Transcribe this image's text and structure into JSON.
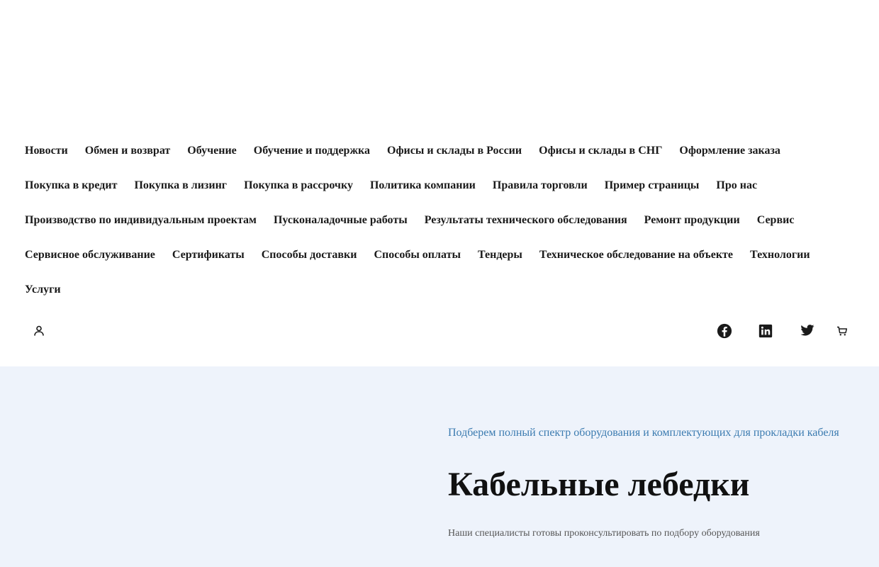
{
  "nav": {
    "items": [
      "Новости",
      "Обмен и возврат",
      "Обучение",
      "Обучение и поддержка",
      "Офисы и склады в России",
      "Офисы и склады в СНГ",
      "Оформление заказа",
      "Покупка в кредит",
      "Покупка в лизинг",
      "Покупка в рассрочку",
      "Политика компании",
      "Правила торговли",
      "Пример страницы",
      "Про нас",
      "Производство по индивидуальным проектам",
      "Пусконаладочные работы",
      "Результаты технического обследования",
      "Ремонт продукции",
      "Сервис",
      "Сервисное обслуживание",
      "Сертификаты",
      "Способы доставки",
      "Способы оплаты",
      "Тендеры",
      "Техническое обследование на объекте",
      "Технологии",
      "Услуги"
    ]
  },
  "toolbar": {
    "user_icon": "user-icon",
    "facebook_icon": "facebook-icon",
    "linkedin_icon": "linkedin-icon",
    "twitter_icon": "twitter-icon",
    "cart_icon": "cart-icon"
  },
  "hero": {
    "kicker": "Подберем полный спектр оборудования и комплектующих для прокладки кабеля",
    "title": "Кабельные лебедки",
    "text": "Наши специалисты готовы проконсультировать по подбору оборудования"
  },
  "colors": {
    "hero_background": "#eef3fb",
    "kicker": "#3b7bb0",
    "title": "#111111"
  }
}
